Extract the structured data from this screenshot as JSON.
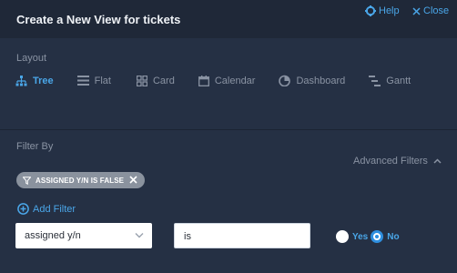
{
  "header": {
    "title": "Create a New View for tickets",
    "help_label": "Help",
    "close_label": "Close"
  },
  "layout": {
    "label": "Layout",
    "options": [
      {
        "label": "Tree",
        "icon": "tree-icon",
        "active": true
      },
      {
        "label": "Flat",
        "icon": "list-icon",
        "active": false
      },
      {
        "label": "Card",
        "icon": "grid-icon",
        "active": false
      },
      {
        "label": "Calendar",
        "icon": "calendar-icon",
        "active": false
      },
      {
        "label": "Dashboard",
        "icon": "dashboard-icon",
        "active": false
      },
      {
        "label": "Gantt",
        "icon": "gantt-icon",
        "active": false
      }
    ]
  },
  "filter": {
    "label": "Filter By",
    "advanced_label": "Advanced Filters",
    "chip_label": "ASSIGNED Y/N IS FALSE",
    "add_filter_label": "Add Filter",
    "field_value": "assigned y/n",
    "operator_value": "is",
    "radio_yes": "Yes",
    "radio_no": "No",
    "selected": "No"
  },
  "colors": {
    "accent": "#4aa6e8",
    "background": "#1f2838",
    "panel": "#253044",
    "chip": "#8a929e"
  }
}
